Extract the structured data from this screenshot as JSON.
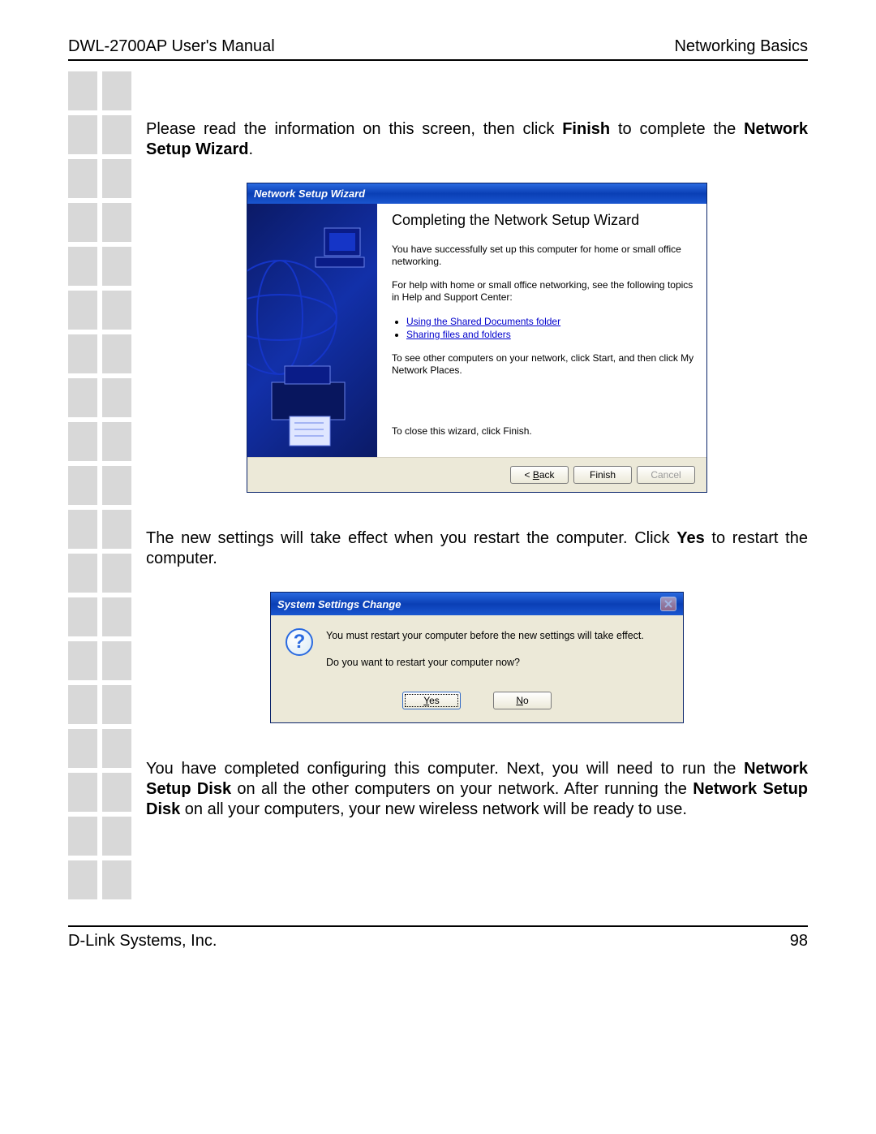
{
  "header": {
    "left": "DWL-2700AP User's Manual",
    "right": "Networking Basics"
  },
  "para1_pre": "Please read the information on this screen, then click ",
  "para1_b1": "Finish",
  "para1_mid": " to complete the ",
  "para1_b2": "Network Setup Wizard",
  "para1_post": ".",
  "wizard": {
    "title": "Network Setup Wizard",
    "heading": "Completing the Network Setup Wizard",
    "p1": "You have successfully set up this computer for home or small office networking.",
    "p2": "For help with home or small office networking, see the following topics in Help and Support Center:",
    "link1": "Using the Shared Documents folder",
    "link2": "Sharing files and folders",
    "p3": "To see other computers on your network, click Start, and then click My Network Places.",
    "close_hint": "To close this wizard, click Finish.",
    "btn_back_u": "B",
    "btn_back_rest": "ack",
    "btn_back_pre": "< ",
    "btn_finish": "Finish",
    "btn_cancel": "Cancel"
  },
  "para2_pre": "The new settings will take effect when you restart the computer. Click ",
  "para2_b1": "Yes",
  "para2_post": " to restart the computer.",
  "msgbox": {
    "title": "System Settings Change",
    "line1": "You must restart your computer before the new settings will take effect.",
    "line2": "Do you want to restart your computer now?",
    "yes_u": "Y",
    "yes_rest": "es",
    "no_u": "N",
    "no_rest": "o"
  },
  "para3_pre": "You have completed configuring this computer. Next, you will need to run the ",
  "para3_b1": "Network Setup Disk",
  "para3_mid1": " on all the other computers on your network. After running the ",
  "para3_b2": "Network Setup Disk",
  "para3_mid2": " on all your computers, your new wireless network will be ready to use.",
  "footer": {
    "left": "D-Link Systems, Inc.",
    "right": "98"
  }
}
